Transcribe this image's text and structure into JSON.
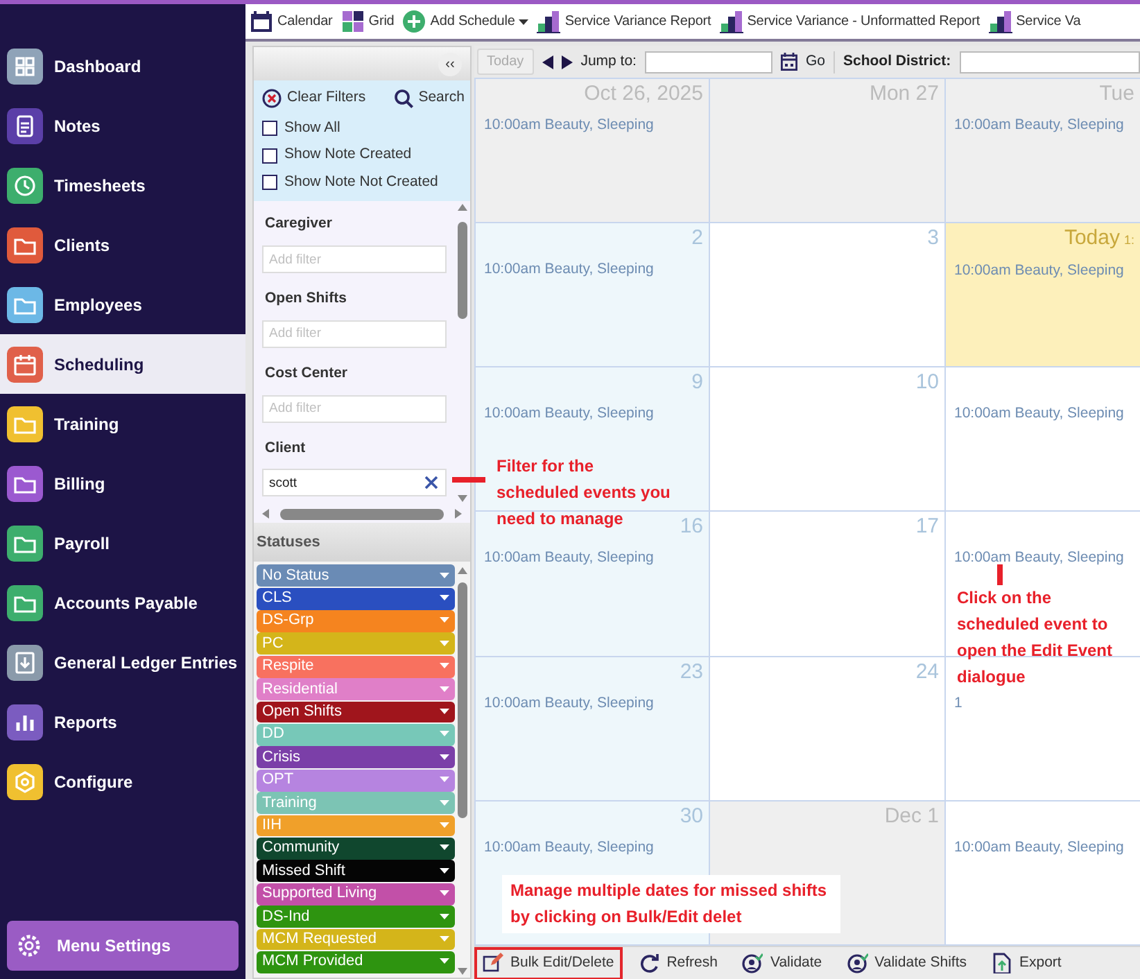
{
  "sidebar": {
    "items": [
      {
        "label": "Dashboard",
        "color": "#8fa3b8",
        "selected": false
      },
      {
        "label": "Notes",
        "color": "#5b3fa8",
        "selected": false
      },
      {
        "label": "Timesheets",
        "color": "#3dae6d",
        "selected": false
      },
      {
        "label": "Clients",
        "color": "#e05a3c",
        "selected": false
      },
      {
        "label": "Employees",
        "color": "#6cb8e6",
        "selected": false
      },
      {
        "label": "Scheduling",
        "color": "#e0604a",
        "selected": true
      },
      {
        "label": "Training",
        "color": "#f0c030",
        "selected": false
      },
      {
        "label": "Billing",
        "color": "#9b59d0",
        "selected": false
      },
      {
        "label": "Payroll",
        "color": "#3dae6d",
        "selected": false
      },
      {
        "label": "Accounts Payable",
        "color": "#3dae6d",
        "selected": false
      },
      {
        "label": "General Ledger Entries",
        "color": "#8a9aaa",
        "selected": false
      },
      {
        "label": "Reports",
        "color": "#7b5cc0",
        "selected": false
      },
      {
        "label": "Configure",
        "color": "#f0c030",
        "selected": false
      }
    ],
    "footer": {
      "label": "Menu Settings"
    }
  },
  "toolbar": {
    "items": [
      {
        "label": "Calendar",
        "kind": "calendar"
      },
      {
        "label": "Grid",
        "kind": "grid"
      },
      {
        "label": "Add Schedule",
        "kind": "add"
      },
      {
        "label": "Service Variance Report",
        "kind": "report"
      },
      {
        "label": "Service Variance - Unformatted Report",
        "kind": "report"
      },
      {
        "label": "Service Va",
        "kind": "report"
      }
    ]
  },
  "filter_panel": {
    "collapse": "‹‹",
    "actions": [
      {
        "label": "Clear Filters",
        "kind": "clear"
      },
      {
        "label": "Search",
        "kind": "search"
      }
    ],
    "checkboxes": [
      {
        "label": "Show All",
        "checked": false
      },
      {
        "label": "Show Note Created",
        "checked": false
      },
      {
        "label": "Show Note Not Created",
        "checked": false
      }
    ],
    "filters": [
      {
        "label": "Caregiver",
        "placeholder": "Add filter"
      },
      {
        "label": "Open Shifts",
        "placeholder": "Add filter"
      },
      {
        "label": "Cost Center",
        "placeholder": "Add filter"
      },
      {
        "label": "Client",
        "value": "scott"
      }
    ],
    "statuses_title": "Statuses",
    "statuses": [
      {
        "label": "No Status",
        "color": "#6a8bb5"
      },
      {
        "label": "CLS",
        "color": "#2a4fc0"
      },
      {
        "label": "DS-Grp",
        "color": "#f5841f"
      },
      {
        "label": "PC",
        "color": "#d4b51a"
      },
      {
        "label": "Respite",
        "color": "#f8715f"
      },
      {
        "label": "Residential",
        "color": "#e07fc8"
      },
      {
        "label": "Open Shifts",
        "color": "#a0151c"
      },
      {
        "label": "DD",
        "color": "#77c8b8"
      },
      {
        "label": "Crisis",
        "color": "#7b3fa8"
      },
      {
        "label": "OPT",
        "color": "#b684e0"
      },
      {
        "label": "Training",
        "color": "#7cc4b4"
      },
      {
        "label": "IIH",
        "color": "#f0a02a"
      },
      {
        "label": "Community",
        "color": "#10472e"
      },
      {
        "label": "Missed Shift",
        "color": "#050505"
      },
      {
        "label": "Supported Living",
        "color": "#c250a8"
      },
      {
        "label": "DS-Ind",
        "color": "#2e9410"
      },
      {
        "label": "MCM Requested",
        "color": "#d4b51a"
      },
      {
        "label": "MCM Provided",
        "color": "#2e9410"
      }
    ]
  },
  "calendar": {
    "nav": {
      "today": "Today",
      "today_disabled": true,
      "jump_label": "Jump to:",
      "go": "Go",
      "district_label": "School District:"
    },
    "weeks": [
      [
        {
          "day": "Oct 26, 2025",
          "kind": "other_month",
          "events": [
            "10:00am Beauty, Sleeping"
          ]
        },
        {
          "day": "Mon 27",
          "kind": "other_month"
        },
        {
          "day": "Tue",
          "kind": "other_month",
          "events": [
            "10:00am Beauty, Sleeping"
          ]
        }
      ],
      [
        {
          "day": "2",
          "kind": "sunday",
          "events": [
            "10:00am Beauty, Sleeping"
          ]
        },
        {
          "day": "3",
          "kind": "weekday"
        },
        {
          "day": "Today",
          "note": "1:",
          "kind": "today",
          "events": [
            "10:00am Beauty, Sleeping"
          ]
        }
      ],
      [
        {
          "day": "9",
          "kind": "sunday",
          "events": [
            "10:00am Beauty, Sleeping"
          ]
        },
        {
          "day": "10",
          "kind": "weekday"
        },
        {
          "kind": "weekday",
          "events": [
            "10:00am Beauty, Sleeping"
          ]
        }
      ],
      [
        {
          "day": "16",
          "kind": "sunday",
          "events": [
            "10:00am Beauty, Sleeping"
          ]
        },
        {
          "day": "17",
          "kind": "weekday"
        },
        {
          "kind": "weekday",
          "events": [
            "10:00am Beauty, Sleeping"
          ]
        }
      ],
      [
        {
          "day": "23",
          "kind": "sunday",
          "events": [
            "10:00am Beauty, Sleeping"
          ]
        },
        {
          "day": "24",
          "kind": "weekday"
        },
        {
          "kind": "weekday",
          "events": [
            "1"
          ]
        }
      ],
      [
        {
          "day": "30",
          "kind": "sunday",
          "events": [
            "10:00am Beauty, Sleeping"
          ]
        },
        {
          "day": "Dec 1",
          "kind": "other_month"
        },
        {
          "kind": "weekday",
          "events": [
            "10:00am Beauty, Sleeping"
          ]
        }
      ]
    ]
  },
  "bottom_toolbar": [
    {
      "label": "Bulk Edit/Delete",
      "kind": "edit",
      "highlighted": true
    },
    {
      "label": "Refresh",
      "kind": "refresh",
      "highlighted": false
    },
    {
      "label": "Validate",
      "kind": "validate",
      "highlighted": false
    },
    {
      "label": "Validate Shifts",
      "kind": "validate",
      "highlighted": false
    },
    {
      "label": "Export",
      "kind": "export",
      "highlighted": false
    }
  ],
  "annotations": [
    {
      "text": "Filter for the scheduled events you need to manage"
    },
    {
      "text": "Click on the scheduled event to open the Edit Event dialogue"
    },
    {
      "text": "Manage multiple dates for missed shifts by clicking on Bulk/Edit delet"
    }
  ]
}
